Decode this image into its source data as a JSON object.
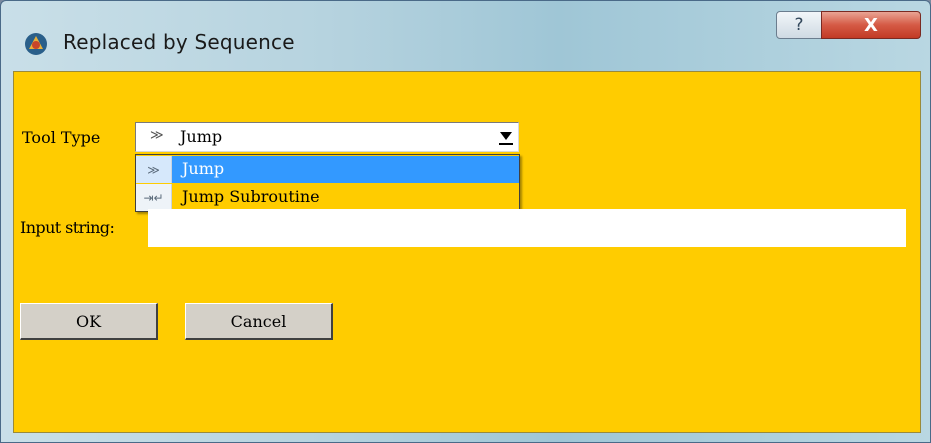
{
  "window": {
    "title": "Replaced by Sequence",
    "help_label": "?",
    "close_label": "X",
    "app_icon": "app-icon"
  },
  "form": {
    "tool_type_label": "Tool Type",
    "tool_type_value": "Jump",
    "tool_type_options": [
      {
        "label": "Jump",
        "icon": "jump-icon",
        "selected": true
      },
      {
        "label": "Jump Subroutine",
        "icon": "jump-subroutine-icon",
        "selected": false
      }
    ],
    "input_string_label": "Input string:",
    "input_string_value": ""
  },
  "buttons": {
    "ok_label": "OK",
    "cancel_label": "Cancel"
  },
  "colors": {
    "client_background": "#ffcc00",
    "selection": "#3399ff",
    "close_button": "#c8432f"
  }
}
